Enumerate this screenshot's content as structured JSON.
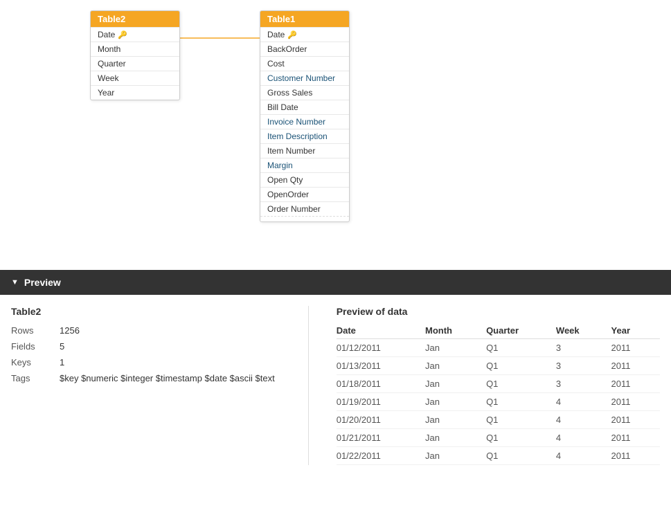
{
  "diagram": {
    "table2": {
      "title": "Table2",
      "fields": [
        {
          "name": "Date",
          "isKey": true
        },
        {
          "name": "Month",
          "isKey": false
        },
        {
          "name": "Quarter",
          "isKey": false
        },
        {
          "name": "Week",
          "isKey": false
        },
        {
          "name": "Year",
          "isKey": false
        }
      ]
    },
    "table1": {
      "title": "Table1",
      "fields": [
        {
          "name": "Date",
          "isKey": true
        },
        {
          "name": "BackOrder",
          "isKey": false
        },
        {
          "name": "Cost",
          "isKey": false
        },
        {
          "name": "Customer Number",
          "isKey": false
        },
        {
          "name": "Gross Sales",
          "isKey": false
        },
        {
          "name": "Bill Date",
          "isKey": false
        },
        {
          "name": "Invoice Number",
          "isKey": false
        },
        {
          "name": "Item Description",
          "isKey": false
        },
        {
          "name": "Item Number",
          "isKey": false
        },
        {
          "name": "Margin",
          "isKey": false
        },
        {
          "name": "Open Qty",
          "isKey": false
        },
        {
          "name": "OpenOrder",
          "isKey": false
        },
        {
          "name": "Order Number",
          "isKey": false
        },
        {
          "name": "...",
          "isKey": false
        }
      ]
    }
  },
  "preview": {
    "header": "Preview",
    "meta": {
      "title": "Table2",
      "rows_label": "Rows",
      "rows_value": "1256",
      "fields_label": "Fields",
      "fields_value": "5",
      "keys_label": "Keys",
      "keys_value": "1",
      "tags_label": "Tags",
      "tags_value": "$key $numeric $integer $timestamp $date $ascii $text"
    },
    "data": {
      "title": "Preview of data",
      "columns": [
        "Date",
        "Month",
        "Quarter",
        "Week",
        "Year"
      ],
      "rows": [
        [
          "01/12/2011",
          "Jan",
          "Q1",
          "3",
          "2011"
        ],
        [
          "01/13/2011",
          "Jan",
          "Q1",
          "3",
          "2011"
        ],
        [
          "01/18/2011",
          "Jan",
          "Q1",
          "3",
          "2011"
        ],
        [
          "01/19/2011",
          "Jan",
          "Q1",
          "4",
          "2011"
        ],
        [
          "01/20/2011",
          "Jan",
          "Q1",
          "4",
          "2011"
        ],
        [
          "01/21/2011",
          "Jan",
          "Q1",
          "4",
          "2011"
        ],
        [
          "01/22/2011",
          "Jan",
          "Q1",
          "4",
          "2011"
        ]
      ]
    }
  }
}
